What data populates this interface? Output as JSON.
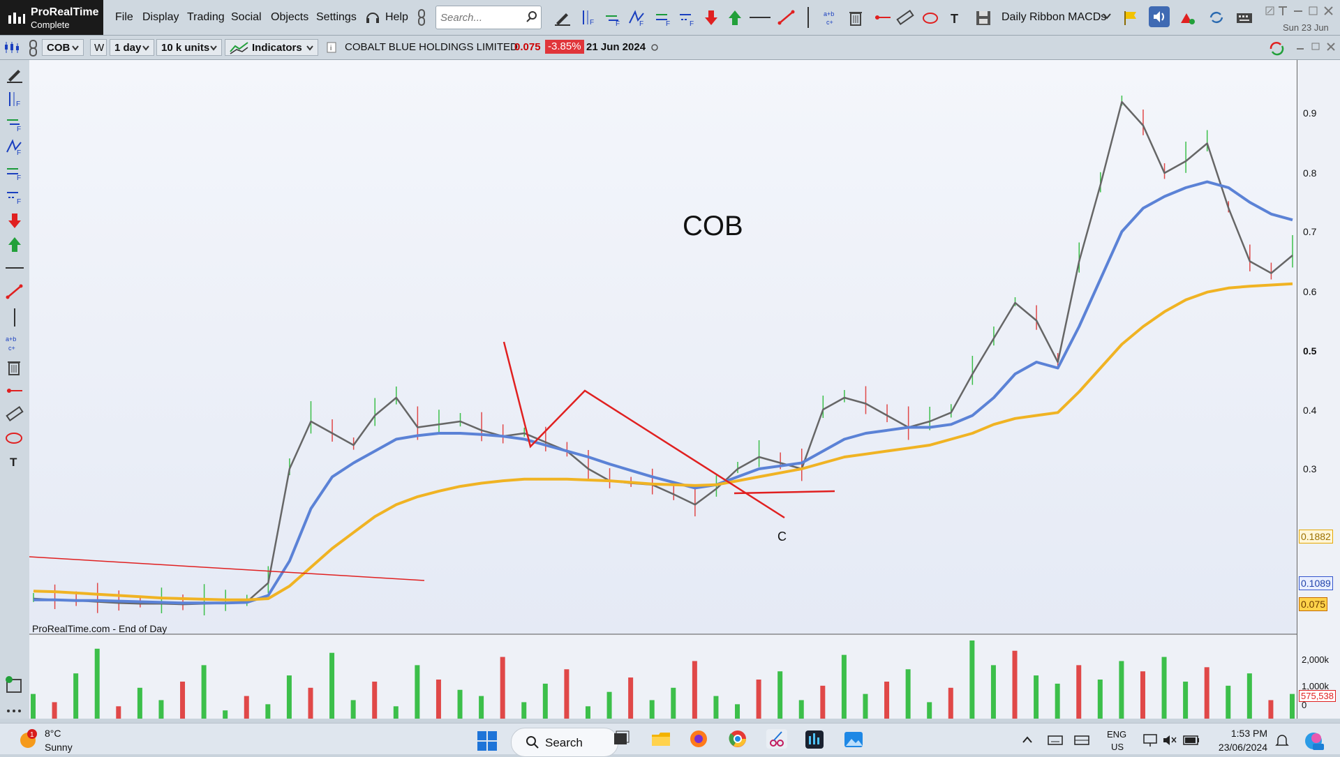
{
  "app": {
    "logo_title": "ProRealTime",
    "logo_subtitle": "Complete",
    "menu": [
      "File",
      "Display",
      "Trading",
      "Social",
      "Objects",
      "Settings",
      "Help"
    ],
    "search_placeholder": "Search...",
    "ribbon_name": "Daily Ribbon MACDs",
    "top_date": "Sun 23 Jun"
  },
  "toolbar2": {
    "symbol": "COB",
    "w_label": "W",
    "interval": "1 day",
    "units": "10 k units",
    "indicators_label": "Indicators",
    "instrument_name": "COBALT BLUE HOLDINGS LIMITED",
    "price": "0.075",
    "change": "-3.85%",
    "date": "21 Jun 2024"
  },
  "chart": {
    "watermark": "ProRealTime.com - End of Day",
    "symbol_label": "COB",
    "annotation_c": "C"
  },
  "chart_data": {
    "type": "bar",
    "title": "COB",
    "price_axis_ticks": [
      "0.9",
      "0.8",
      "0.7",
      "0.6",
      "0.5",
      "0.4",
      "0.3"
    ],
    "price_markers": [
      {
        "label": "0.1882",
        "color": "#e6a800"
      },
      {
        "label": "0.1089",
        "color": "#3355cc"
      },
      {
        "label": "0.075",
        "color": "#c46a00"
      }
    ],
    "volume_ticks": [
      "2,000k",
      "1,000k",
      "0"
    ],
    "volume_last": "575,538",
    "series": [
      {
        "name": "Close",
        "color": "#666666",
        "values": [
          0.12,
          0.118,
          0.117,
          0.115,
          0.113,
          0.112,
          0.112,
          0.111,
          0.112,
          0.113,
          0.115,
          0.145,
          0.3,
          0.38,
          0.36,
          0.34,
          0.39,
          0.42,
          0.37,
          0.375,
          0.38,
          0.365,
          0.355,
          0.36,
          0.345,
          0.33,
          0.3,
          0.285,
          0.282,
          0.28,
          0.268,
          0.255,
          0.275,
          0.3,
          0.32,
          0.31,
          0.3,
          0.4,
          0.42,
          0.41,
          0.39,
          0.37,
          0.38,
          0.395,
          0.46,
          0.52,
          0.58,
          0.55,
          0.48,
          0.65,
          0.78,
          0.92,
          0.88,
          0.8,
          0.82,
          0.85,
          0.74,
          0.65,
          0.63,
          0.66
        ]
      },
      {
        "name": "MA short",
        "color": "#5b82d6",
        "values": [
          0.118,
          0.118,
          0.117,
          0.117,
          0.116,
          0.115,
          0.114,
          0.113,
          0.113,
          0.113,
          0.114,
          0.125,
          0.18,
          0.25,
          0.29,
          0.31,
          0.33,
          0.35,
          0.356,
          0.36,
          0.36,
          0.358,
          0.355,
          0.35,
          0.34,
          0.33,
          0.32,
          0.308,
          0.298,
          0.29,
          0.283,
          0.276,
          0.28,
          0.29,
          0.3,
          0.305,
          0.31,
          0.33,
          0.35,
          0.36,
          0.365,
          0.37,
          0.37,
          0.375,
          0.39,
          0.42,
          0.46,
          0.48,
          0.47,
          0.54,
          0.62,
          0.7,
          0.74,
          0.76,
          0.775,
          0.785,
          0.775,
          0.75,
          0.73,
          0.72
        ]
      },
      {
        "name": "MA long",
        "color": "#f0b323",
        "values": [
          0.132,
          0.131,
          0.129,
          0.127,
          0.125,
          0.123,
          0.121,
          0.12,
          0.119,
          0.118,
          0.118,
          0.12,
          0.14,
          0.17,
          0.2,
          0.22,
          0.24,
          0.255,
          0.265,
          0.272,
          0.278,
          0.282,
          0.285,
          0.287,
          0.287,
          0.287,
          0.286,
          0.285,
          0.283,
          0.281,
          0.28,
          0.279,
          0.28,
          0.285,
          0.29,
          0.295,
          0.3,
          0.31,
          0.32,
          0.325,
          0.33,
          0.335,
          0.34,
          0.35,
          0.36,
          0.375,
          0.385,
          0.39,
          0.395,
          0.43,
          0.47,
          0.51,
          0.54,
          0.565,
          0.585,
          0.598,
          0.605,
          0.608,
          0.61,
          0.612
        ]
      }
    ],
    "volume": [
      120,
      80,
      220,
      340,
      60,
      150,
      90,
      180,
      260,
      40,
      110,
      70,
      210,
      150,
      320,
      90,
      180,
      60,
      260,
      190,
      140,
      110,
      300,
      80,
      170,
      240,
      60,
      130,
      200,
      90,
      150,
      280,
      110,
      70,
      190,
      230,
      90,
      160,
      310,
      120,
      180,
      240,
      80,
      150,
      380,
      260,
      330,
      210,
      170,
      260,
      190,
      280,
      230,
      300,
      180,
      250,
      160,
      220,
      90,
      120
    ]
  },
  "taskbar": {
    "weather_temp": "8°C",
    "weather_desc": "Sunny",
    "weather_badge": "1",
    "search_label": "Search",
    "lang_top": "ENG",
    "lang_bottom": "US",
    "time": "1:53 PM",
    "date": "23/06/2024"
  }
}
